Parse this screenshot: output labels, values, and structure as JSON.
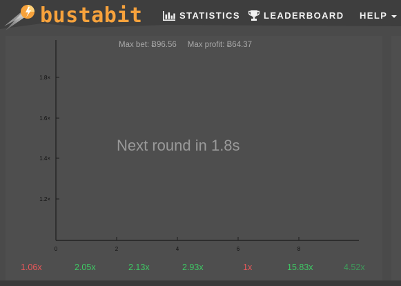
{
  "app": {
    "name": "bustabit"
  },
  "nav": {
    "statistics": "STATISTICS",
    "leaderboard": "LEADERBOARD",
    "help": "HELP"
  },
  "limits": {
    "max_bet": "Max bet: Ƀ96.56",
    "max_profit": "Max profit: Ƀ64.37"
  },
  "status": {
    "countdown": "Next round in 1.8s"
  },
  "chart_data": {
    "type": "line",
    "x_ticks": [
      "0",
      "2",
      "4",
      "6",
      "8"
    ],
    "y_ticks": [
      "1.8×",
      "1.6×",
      "1.4×",
      "1.2×"
    ],
    "series": []
  },
  "history": [
    {
      "value": "1.06x",
      "color": "#e8585a"
    },
    {
      "value": "2.05x",
      "color": "#3ec964"
    },
    {
      "value": "2.13x",
      "color": "#3ec964"
    },
    {
      "value": "2.93x",
      "color": "#3ec964"
    },
    {
      "value": "1x",
      "color": "#e8585a"
    },
    {
      "value": "15.83x",
      "color": "#3ec964"
    },
    {
      "value": "4.52x",
      "color": "#3e9a5a"
    }
  ],
  "colors": {
    "brand": "#f7a23c",
    "background": "#4a4a4a",
    "crash": "#e8585a",
    "win": "#3ec964"
  }
}
